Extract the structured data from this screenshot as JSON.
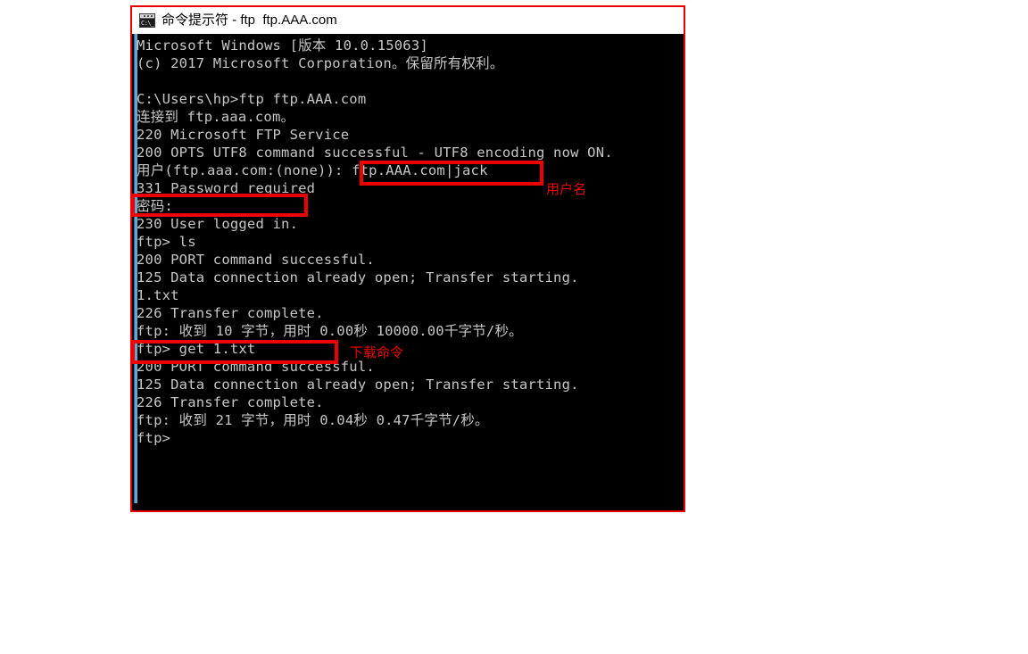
{
  "window": {
    "title": "命令提示符 - ftp  ftp.AAA.com",
    "icon": "cmd-console-icon",
    "icon_glyph": "C:\\_",
    "border_color": "#ee0000",
    "titlebar_bg": "#ffffff",
    "console_bg": "#000000",
    "console_fg": "#c6c6c6"
  },
  "console": {
    "lines": [
      "Microsoft Windows [版本 10.0.15063]",
      "(c) 2017 Microsoft Corporation。保留所有权利。",
      "",
      "C:\\Users\\hp>ftp ftp.AAA.com",
      "连接到 ftp.aaa.com。",
      "220 Microsoft FTP Service",
      "200 OPTS UTF8 command successful - UTF8 encoding now ON.",
      "用户(ftp.aaa.com:(none)): ftp.AAA.com|jack",
      "331 Password required",
      "密码:",
      "230 User logged in.",
      "ftp> ls",
      "200 PORT command successful.",
      "125 Data connection already open; Transfer starting.",
      "1.txt",
      "226 Transfer complete.",
      "ftp: 收到 10 字节，用时 0.00秒 10000.00千字节/秒。",
      "ftp> get 1.txt",
      "200 PORT command successful.",
      "125 Data connection already open; Transfer starting.",
      "226 Transfer complete.",
      "ftp: 收到 21 字节，用时 0.04秒 0.47千字节/秒。",
      "ftp>"
    ]
  },
  "annotations": {
    "color": "#ee0000",
    "boxes": [
      {
        "name": "username-entry",
        "target": "ftp.AAA.com|jack"
      },
      {
        "name": "password-prompt",
        "target": "密码:"
      },
      {
        "name": "get-command",
        "target": "ftp> get 1.txt"
      }
    ],
    "labels": {
      "username": "用户名",
      "download_command": "下载命令"
    }
  }
}
